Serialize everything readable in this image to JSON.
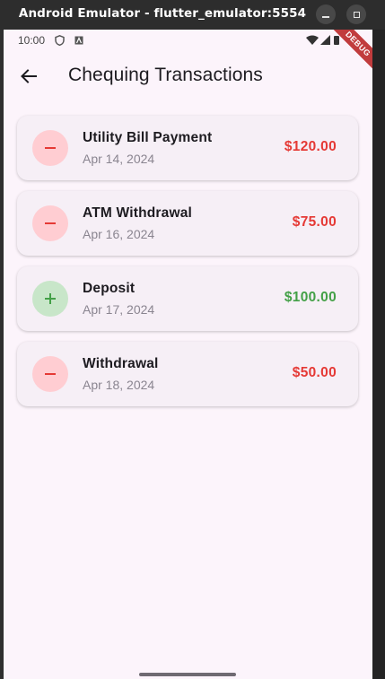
{
  "window": {
    "title": "Android Emulator - flutter_emulator:5554"
  },
  "statusbar": {
    "time": "10:00"
  },
  "debug_banner": "DEBUG",
  "appbar": {
    "title": "Chequing Transactions"
  },
  "transactions": [
    {
      "title": "Utility Bill Payment",
      "date": "Apr 14, 2024",
      "amount": "$120.00",
      "type": "debit"
    },
    {
      "title": "ATM Withdrawal",
      "date": "Apr 16, 2024",
      "amount": "$75.00",
      "type": "debit"
    },
    {
      "title": "Deposit",
      "date": "Apr 17, 2024",
      "amount": "$100.00",
      "type": "credit"
    },
    {
      "title": "Withdrawal",
      "date": "Apr 18, 2024",
      "amount": "$50.00",
      "type": "debit"
    }
  ],
  "colors": {
    "debit": "#e53935",
    "credit": "#43a047",
    "debit_bg": "#ffcdd2",
    "credit_bg": "#c8e6c9",
    "background": "#fcf4fb",
    "card": "#f6eff6"
  },
  "icons": {
    "back": "arrow-back-icon",
    "debit": "minus-icon",
    "credit": "plus-icon"
  }
}
